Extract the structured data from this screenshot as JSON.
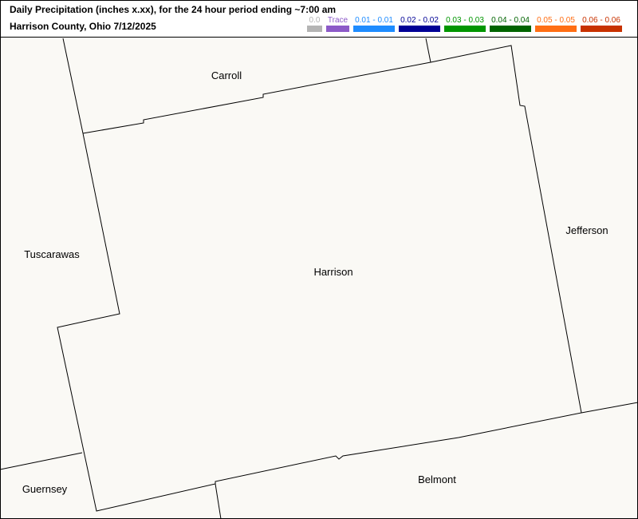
{
  "header": {
    "title_line1": "Daily Precipitation (inches  x.xx),  for the 24 hour period ending ~7:00 am",
    "title_line2": "Harrison County, Ohio  7/12/2025"
  },
  "legend": [
    {
      "label": "0.0",
      "color": "#b4b4b4"
    },
    {
      "label": "Trace",
      "color": "#8c5ac8"
    },
    {
      "label": "0.01 - 0.01",
      "color": "#1e8cff"
    },
    {
      "label": "0.02 - 0.02",
      "color": "#000096"
    },
    {
      "label": "0.03 - 0.03",
      "color": "#009600"
    },
    {
      "label": "0.04 - 0.04",
      "color": "#006400"
    },
    {
      "label": "0.05 - 0.05",
      "color": "#ff6e14"
    },
    {
      "label": "0.06 - 0.06",
      "color": "#c83200"
    }
  ],
  "counties": {
    "carroll": "Carroll",
    "tuscarawas": "Tuscarawas",
    "harrison": "Harrison",
    "jefferson": "Jefferson",
    "guernsey": "Guernsey",
    "belmont": "Belmont"
  },
  "map_colors": {
    "background": "#faf9f5",
    "boundary": "#000000"
  }
}
